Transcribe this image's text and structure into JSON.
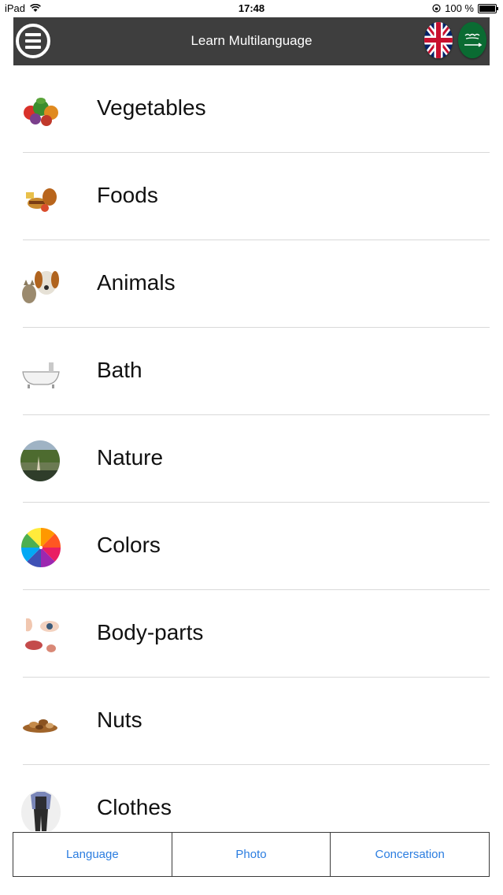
{
  "status": {
    "device": "iPad",
    "time": "17:48",
    "battery": "100 %"
  },
  "header": {
    "title": "Learn Multilanguage"
  },
  "categories": [
    {
      "label": "Vegetables"
    },
    {
      "label": "Foods"
    },
    {
      "label": "Animals"
    },
    {
      "label": "Bath"
    },
    {
      "label": "Nature"
    },
    {
      "label": "Colors"
    },
    {
      "label": "Body-parts"
    },
    {
      "label": "Nuts"
    },
    {
      "label": "Clothes"
    }
  ],
  "tabs": [
    {
      "label": "Language"
    },
    {
      "label": "Photo"
    },
    {
      "label": "Concersation"
    }
  ],
  "colors": {
    "navbar": "#3e3e3e",
    "tab_text": "#2b7de0"
  }
}
